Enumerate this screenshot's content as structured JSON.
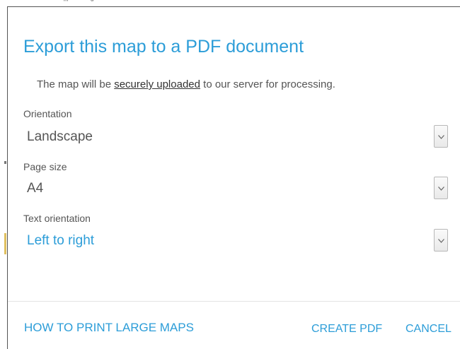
{
  "dialog": {
    "title": "Export this map to a PDF document",
    "notice": {
      "before": "The map will be ",
      "link": "securely uploaded",
      "after": " to our server for processing."
    },
    "fields": [
      {
        "label": "Orientation",
        "value": "Landscape"
      },
      {
        "label": "Page size",
        "value": "A4"
      },
      {
        "label": "Text orientation",
        "value": "Left to right"
      }
    ],
    "footer": {
      "help_link": "HOW TO PRINT LARGE MAPS",
      "create_button": "CREATE PDF",
      "cancel_button": "CANCEL"
    }
  },
  "icons": {
    "select_arrow": "chevron-down-icon"
  },
  "colors": {
    "accent": "#2c9dd8",
    "text": "#555555",
    "link_dark": "#333333",
    "divider": "#e4e4e4"
  }
}
